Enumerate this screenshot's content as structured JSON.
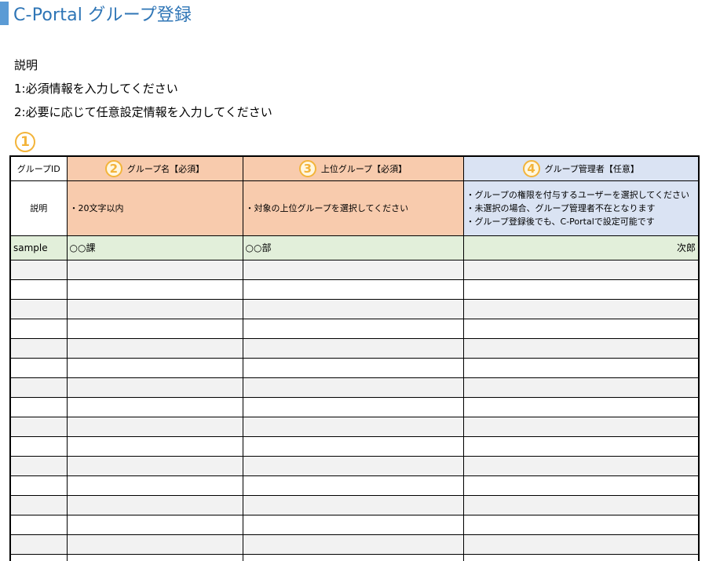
{
  "title": "C-Portal グループ登録",
  "description": {
    "heading": "説明",
    "lines": [
      "1:必須情報を入力してください",
      "2:必要に応じて任意設定情報を入力してください"
    ]
  },
  "markers": [
    "①",
    "2",
    "3",
    "4"
  ],
  "columns": {
    "id": "グループID",
    "name": "グループ名【必須】",
    "upper": "上位グループ【必須】",
    "admin": "グループ管理者【任意】"
  },
  "explanation": {
    "label": "説明",
    "name": "・20文字以内",
    "upper": "・対象の上位グループを選択してください",
    "admin": [
      "・グループの権限を付与するユーザーを選択してください",
      "・未選択の場合、グループ管理者不在となります",
      "・グループ登録後でも、C-Portalで設定可能です"
    ]
  },
  "sample": {
    "id": "sample",
    "name": "○○課",
    "upper": "○○部",
    "admin": "次郎"
  },
  "colors": {
    "title": "#2e75b6",
    "accent": "#5b9bd5",
    "required_header": "#f8cbad",
    "optional_header": "#dae3f3",
    "sample_row": "#e2efda",
    "marker": "#f3b43a"
  }
}
